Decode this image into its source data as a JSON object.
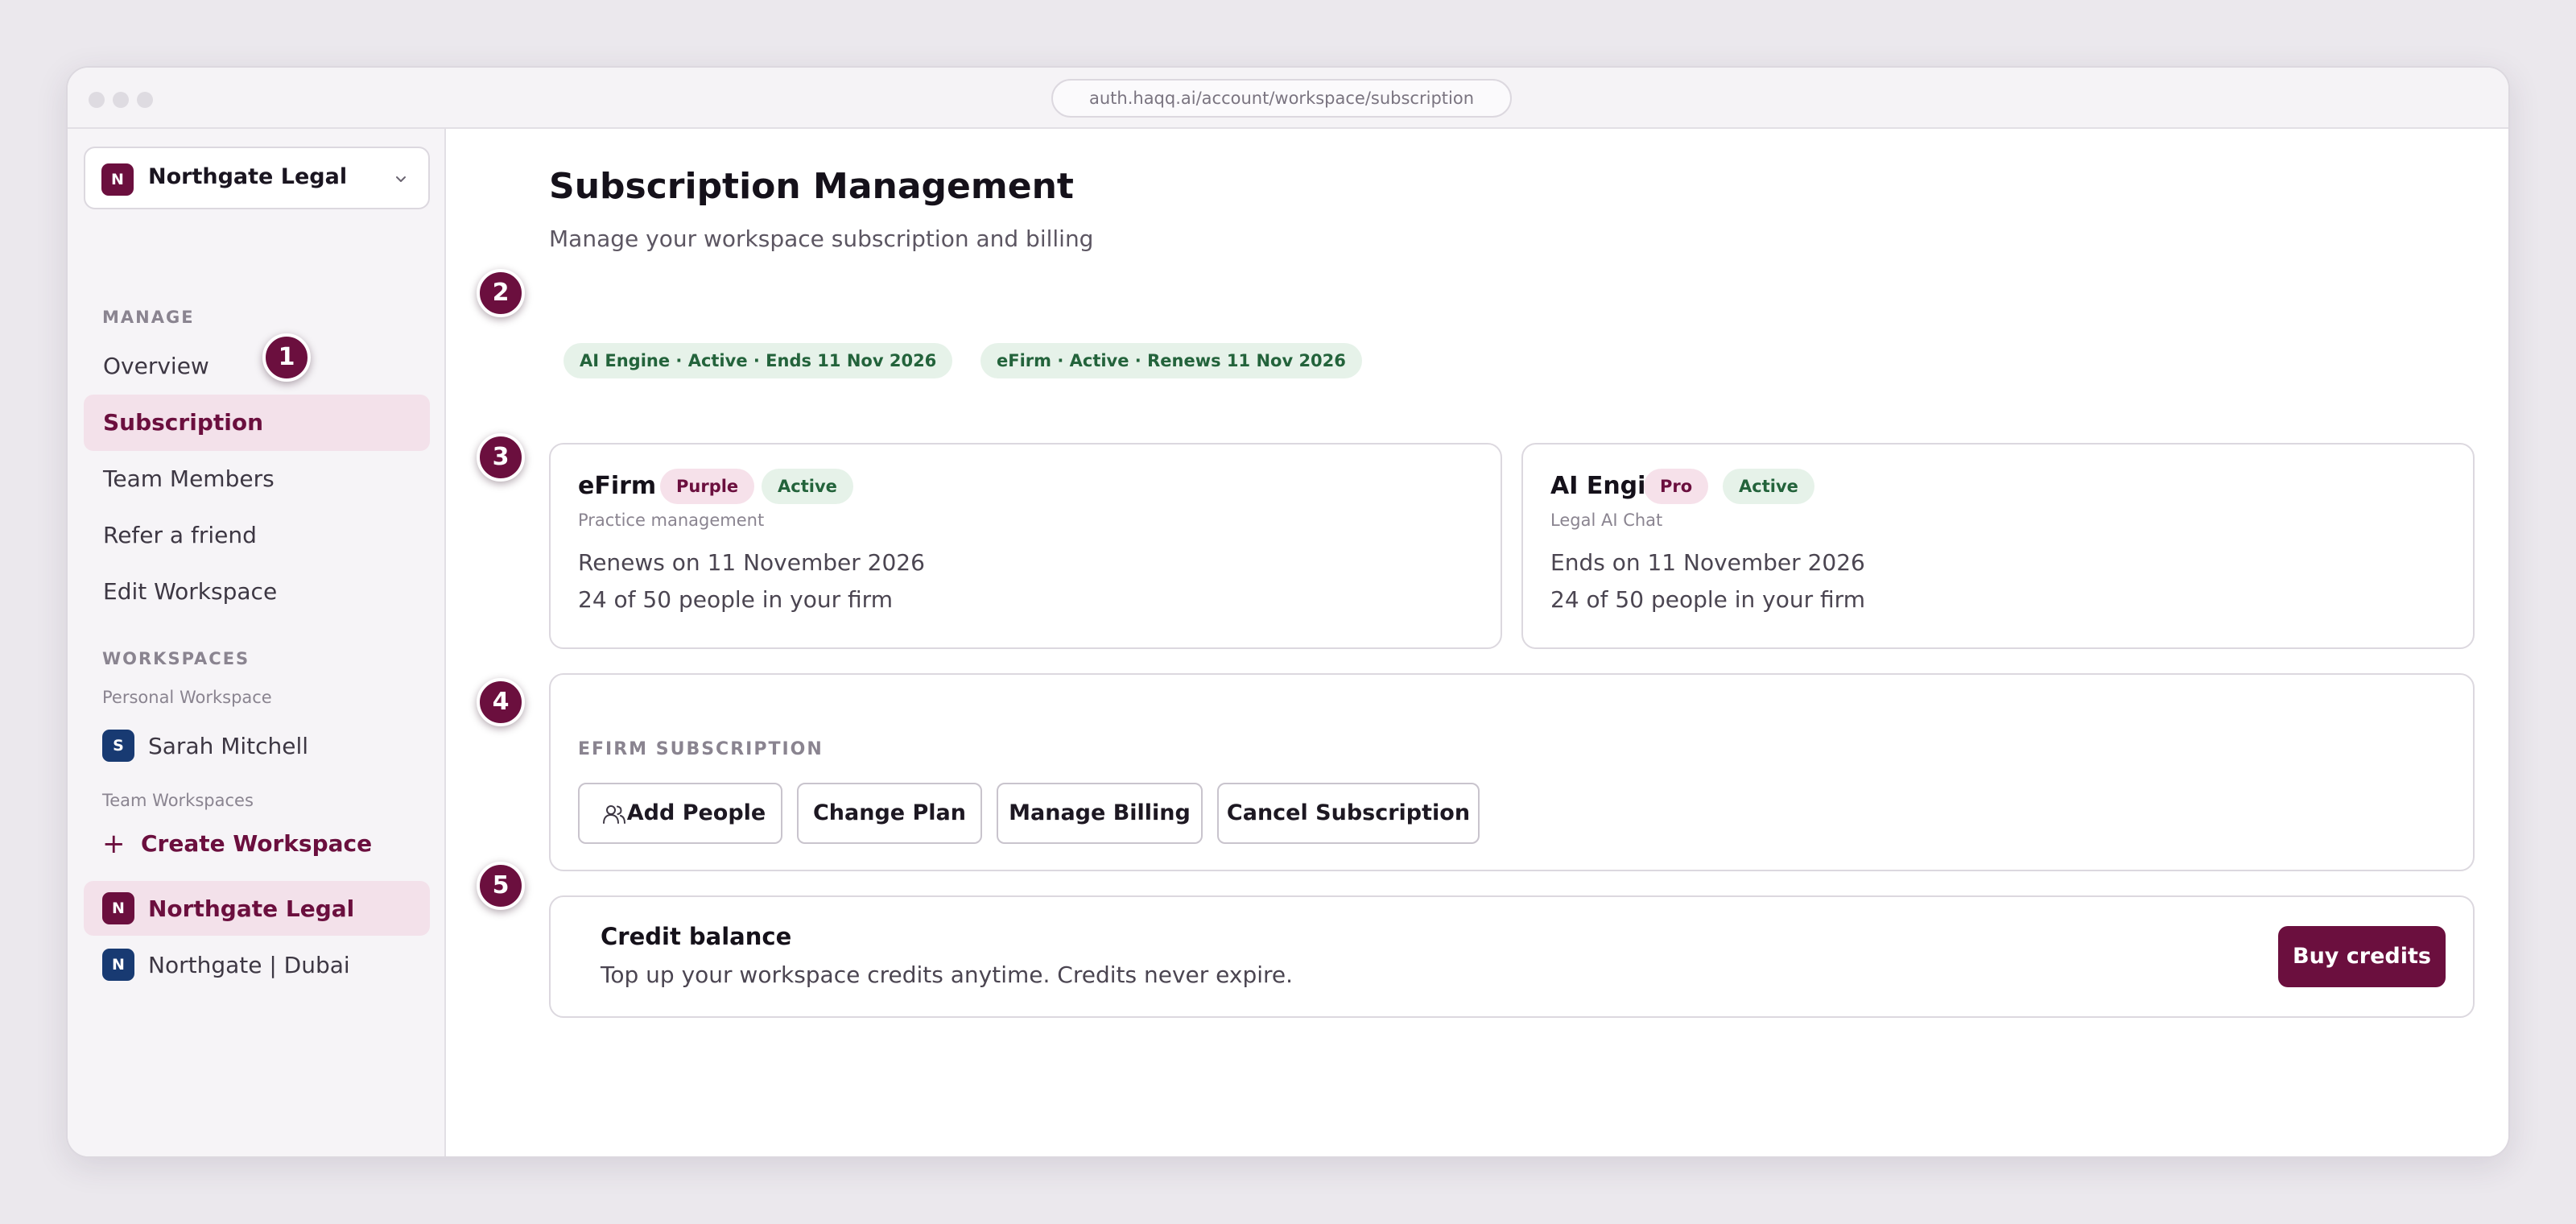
{
  "browser": {
    "url": "auth.haqq.ai/account/workspace/subscription"
  },
  "sidebar": {
    "workspace_selector": {
      "initial": "N",
      "name": "Northgate Legal"
    },
    "manage_label": "MANAGE",
    "nav": [
      {
        "label": "Overview"
      },
      {
        "label": "Subscription"
      },
      {
        "label": "Team Members"
      },
      {
        "label": "Refer a friend"
      },
      {
        "label": "Edit Workspace"
      }
    ],
    "workspaces_label": "WORKSPACES",
    "personal_label": "Personal Workspace",
    "personal_workspace": {
      "initial": "S",
      "name": "Sarah Mitchell"
    },
    "team_label": "Team Workspaces",
    "create_label": "Create Workspace",
    "team_workspaces": [
      {
        "initial": "N",
        "name": "Northgate Legal"
      },
      {
        "initial": "N",
        "name": "Northgate | Dubai"
      }
    ]
  },
  "main": {
    "title": "Subscription Management",
    "subtitle": "Manage your workspace subscription and billing",
    "status_pills": [
      "AI Engine · Active · Ends 11 Nov 2026",
      "eFirm · Active · Renews 11 Nov 2026"
    ],
    "products": [
      {
        "name": "eFirm",
        "plan": "Purple",
        "status": "Active",
        "category": "Practice management",
        "date_line": "Renews on 11 November 2026",
        "seats_line": "24 of 50 people in your firm"
      },
      {
        "name": "AI Engine",
        "plan": "Pro",
        "status": "Active",
        "category": "Legal AI Chat",
        "date_line": "Ends on 11 November 2026",
        "seats_line": "24 of 50 people in your firm"
      }
    ],
    "efirm_actions": {
      "heading": "EFIRM SUBSCRIPTION",
      "buttons": [
        "Add People",
        "Change Plan",
        "Manage Billing",
        "Cancel Subscription"
      ]
    },
    "credits": {
      "title": "Credit balance",
      "description": "Top up your workspace credits anytime. Credits never expire.",
      "button": "Buy credits"
    }
  },
  "markers": [
    "1",
    "2",
    "3",
    "4",
    "5"
  ],
  "colors": {
    "brand": "#6b0f3e",
    "active_green_bg": "#e6f2e9",
    "active_green_text": "#23633b",
    "navy_avatar": "#183a72"
  }
}
